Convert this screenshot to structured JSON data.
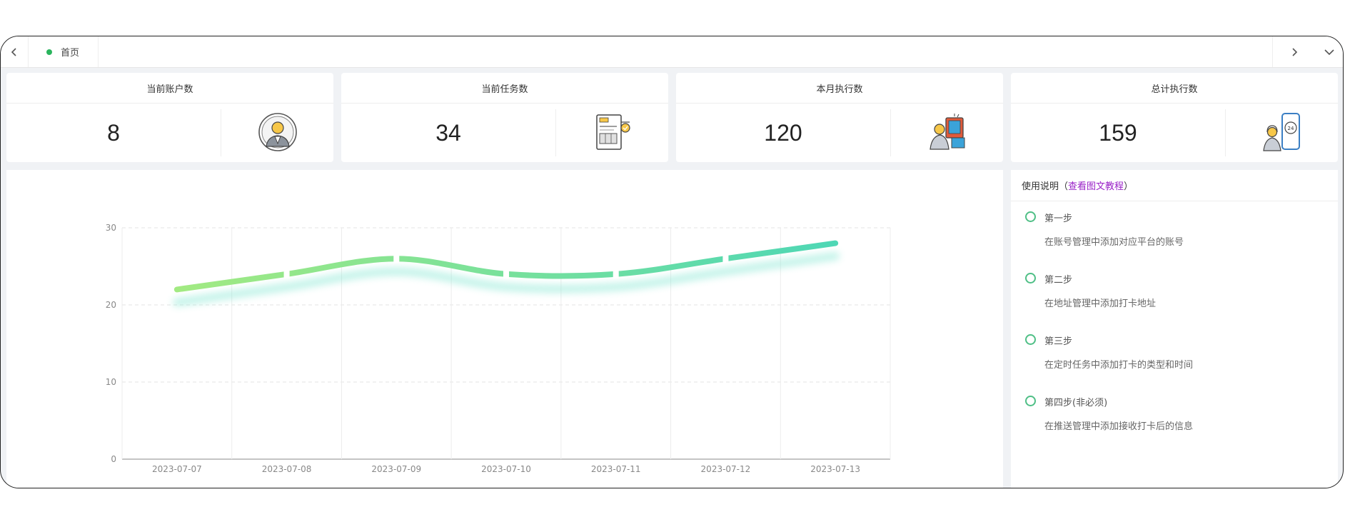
{
  "tabs": {
    "prev_icon": "chevron-left-icon",
    "next_icon": "chevron-right-icon",
    "more_icon": "chevron-down-icon",
    "items": [
      {
        "label": "首页",
        "active": true
      }
    ]
  },
  "stats": [
    {
      "label": "当前账户数",
      "value": "8",
      "icon": "user-avatar-icon"
    },
    {
      "label": "当前任务数",
      "value": "34",
      "icon": "invoice-document-icon"
    },
    {
      "label": "本月执行数",
      "value": "120",
      "icon": "person-at-screen-icon"
    },
    {
      "label": "总计执行数",
      "value": "159",
      "icon": "support-phone-24h-icon"
    }
  ],
  "chart_data": {
    "type": "line",
    "categories": [
      "2023-07-07",
      "2023-07-08",
      "2023-07-09",
      "2023-07-10",
      "2023-07-11",
      "2023-07-12",
      "2023-07-13"
    ],
    "series": [
      {
        "values": [
          22,
          24,
          26,
          24,
          24,
          26,
          28
        ]
      }
    ],
    "ylim": [
      0,
      30
    ],
    "yticks": [
      0,
      10,
      20,
      30
    ],
    "smooth": true,
    "grid": true,
    "colors": [
      "#a2ea82",
      "#4ed7b5"
    ]
  },
  "help": {
    "title": "使用说明（",
    "link": "查看图文教程",
    "title_end": "）",
    "steps": [
      {
        "title": "第一步",
        "desc": "在账号管理中添加对应平台的账号"
      },
      {
        "title": "第二步",
        "desc": "在地址管理中添加打卡地址"
      },
      {
        "title": "第三步",
        "desc": "在定时任务中添加打卡的类型和时间"
      },
      {
        "title": "第四步(非必须)",
        "desc": "在推送管理中添加接收打卡后的信息"
      }
    ]
  }
}
